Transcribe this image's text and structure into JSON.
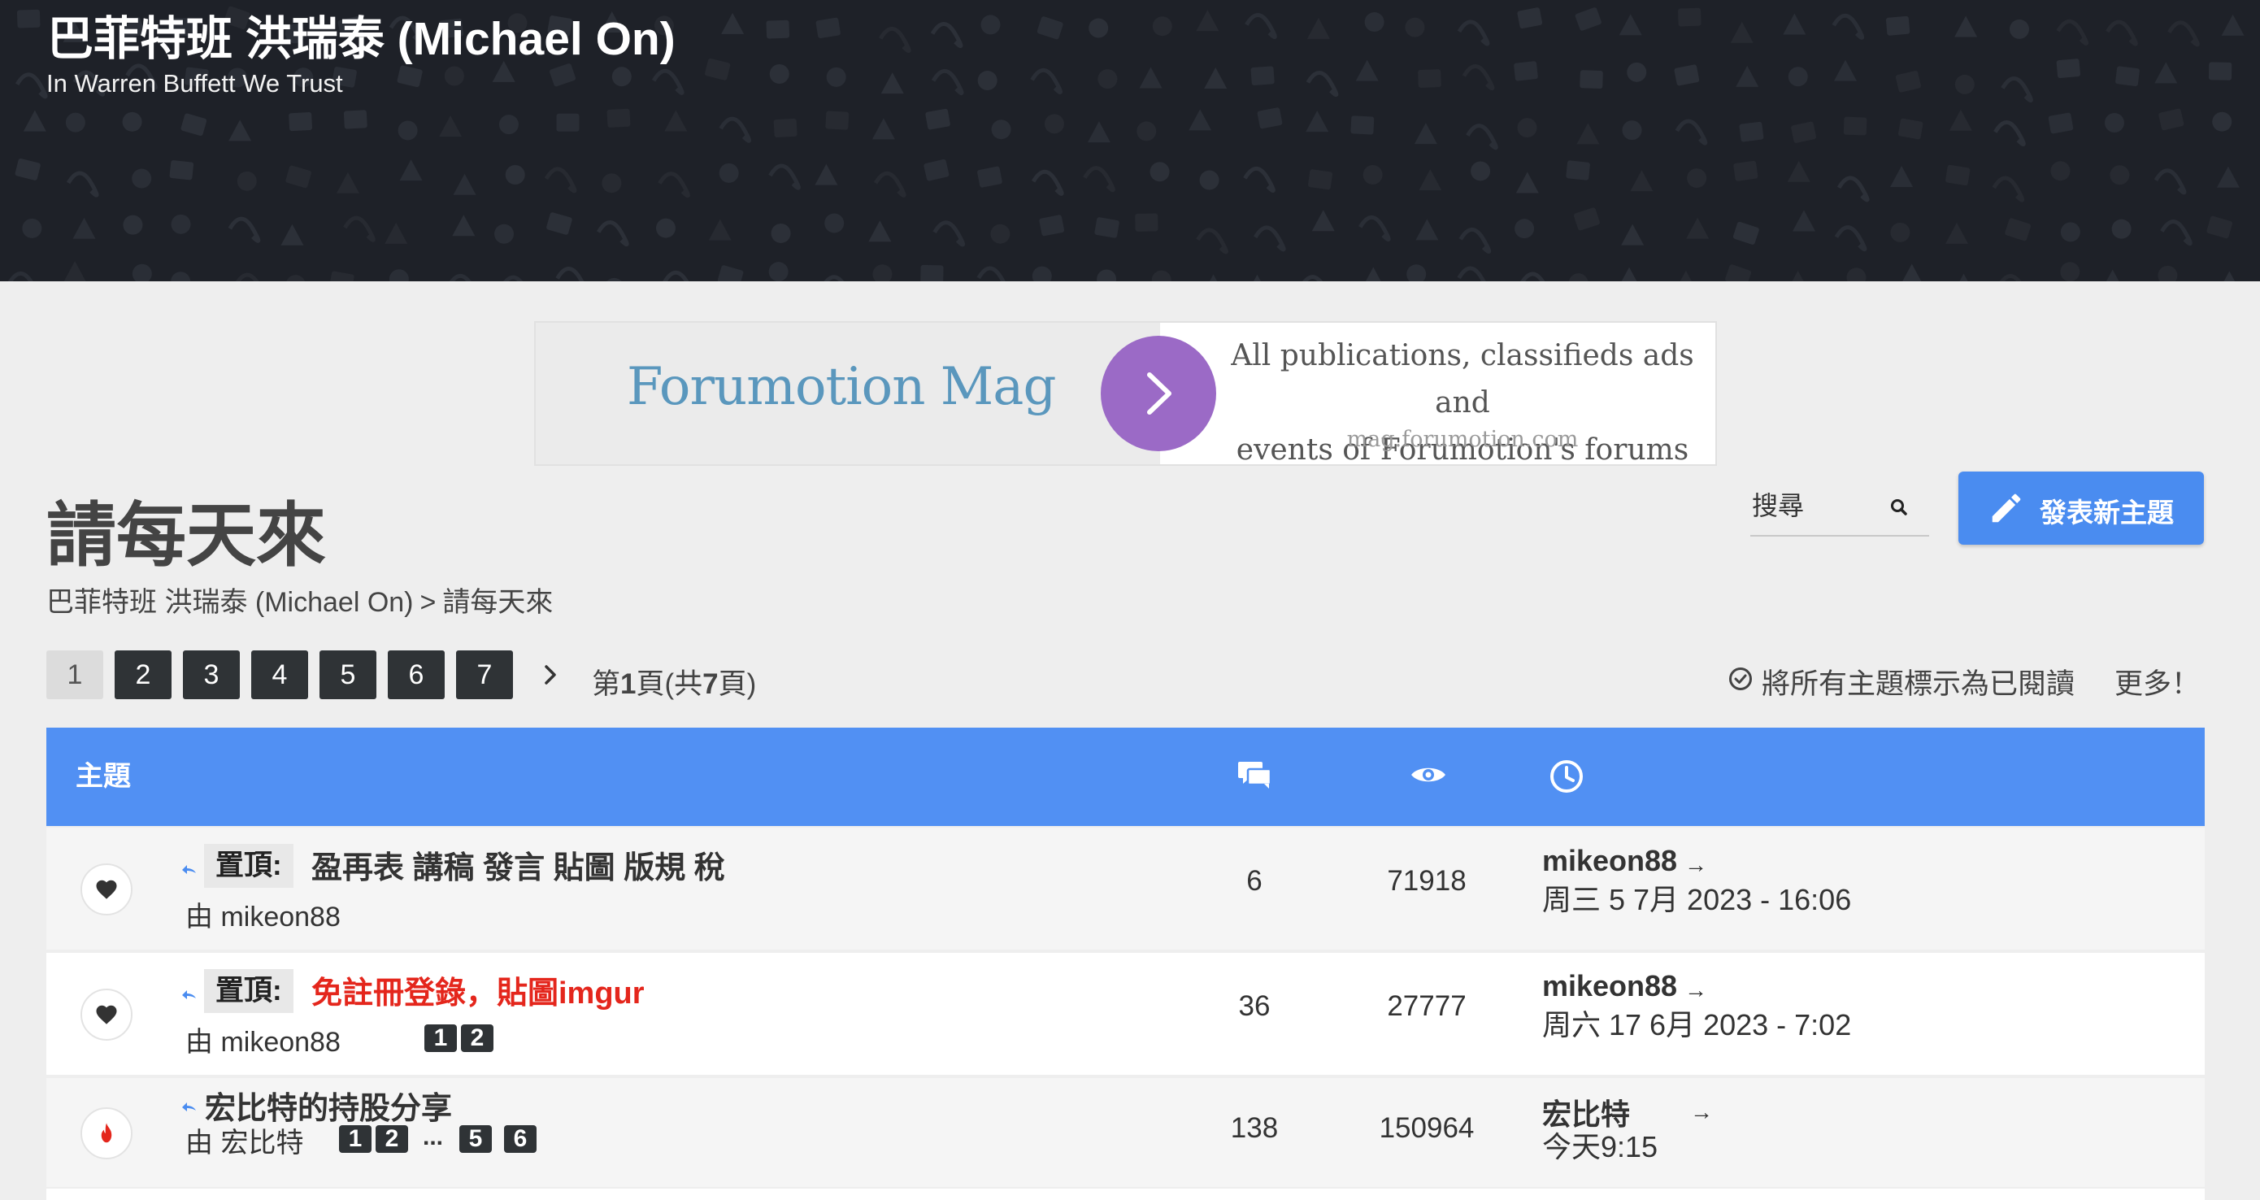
{
  "header": {
    "title": "巴菲特班 洪瑞泰 (Michael On)",
    "description": "In Warren Buffett We Trust",
    "background_color": "#1e2128"
  },
  "ad": {
    "brand": "Forumotion Mag",
    "text_line1": "All publications, classifieds ads and",
    "text_line2": "events of Forumotion's forums",
    "url": "mag.forumotion.com",
    "accent_color": "#9b6ac6"
  },
  "page": {
    "title": "請每天來",
    "breadcrumb": {
      "home": "巴菲特班 洪瑞泰 (Michael On)",
      "separator": ">",
      "current": "請每天來"
    }
  },
  "search": {
    "placeholder": "搜尋",
    "icon": "search-icon"
  },
  "new_topic": {
    "label": "發表新主題",
    "icon": "pencil-icon",
    "color": "#4a8cf0"
  },
  "pagination": {
    "current": "1",
    "pages": [
      "2",
      "3",
      "4",
      "5",
      "6",
      "7"
    ],
    "next_icon": "chevron-right-icon",
    "info_prefix": "第",
    "info_page": "1",
    "info_middle": "頁(共",
    "info_total": "7",
    "info_suffix": "頁)"
  },
  "actions": {
    "mark_read": "將所有主題標示為已閱讀",
    "more": "更多！"
  },
  "table": {
    "header_color": "#5190f3",
    "col_topic": "主題",
    "col_replies_icon": "speech-bubbles-icon",
    "col_views_icon": "eye-icon",
    "col_last_post_icon": "clock-icon"
  },
  "topics": [
    {
      "status_icon": "heart-icon",
      "prefix": "置頂:",
      "title": "盈再表 講稿 發言 貼圖 版規 稅",
      "author_label": "由 mikeon88",
      "replies": "6",
      "views": "71918",
      "last_user": "mikeon88",
      "last_arrow": "→",
      "last_date": "周三 5 7月 2023 - 16:06"
    },
    {
      "status_icon": "heart-icon",
      "prefix": "置頂:",
      "title": "免註冊登錄，貼圖imgur",
      "title_color": "#e4261c",
      "author_label": "由 mikeon88",
      "mini_pages": [
        "1",
        "2"
      ],
      "replies": "36",
      "views": "27777",
      "last_user": "mikeon88",
      "last_arrow": "→",
      "last_date": "周六 17 6月 2023 - 7:02"
    },
    {
      "status_icon": "fire-icon",
      "title": "宏比特的持股分享",
      "author_label": "由 宏比特",
      "mini_pages": [
        "1",
        "2",
        "5",
        "6"
      ],
      "mini_ellipsis": "...",
      "replies": "138",
      "views": "150964",
      "last_user": "宏比特",
      "last_arrow": "→",
      "last_date": "今天9:15"
    }
  ]
}
